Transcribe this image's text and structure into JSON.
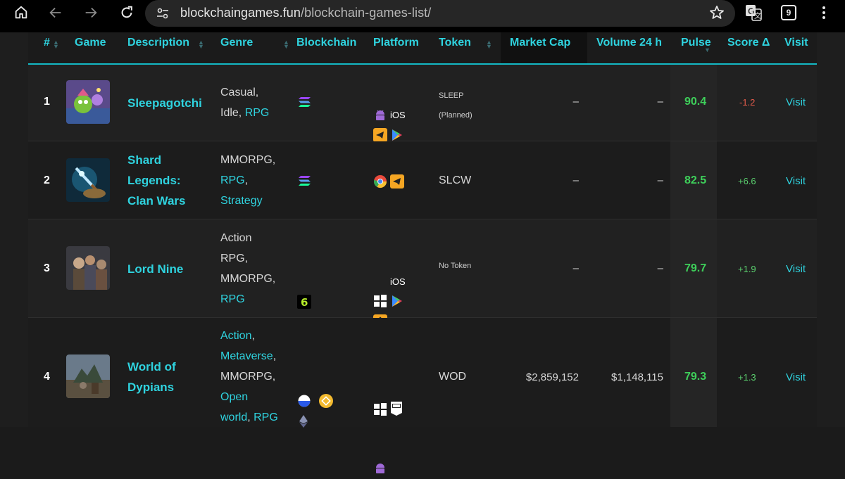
{
  "browser": {
    "url_domain": "blockchaingames.fun",
    "url_path": "/blockchain-games-list/",
    "tab_count": "9"
  },
  "table": {
    "headers": {
      "rank": "#",
      "game": "Game",
      "description": "Description",
      "genre": "Genre",
      "blockchain": "Blockchain",
      "platform": "Platform",
      "token": "Token",
      "market_cap": "Market Cap",
      "volume": "Volume 24 h",
      "pulse": "Pulse",
      "score": "Score Δ",
      "visit": "Visit"
    },
    "rows": [
      {
        "rank": "1",
        "name_lines": [
          "Sleepagotchi"
        ],
        "genre_plain": [
          "Casual,",
          "Idle, "
        ],
        "genre_link_last": "RPG",
        "blockchain": [
          "solana-icon"
        ],
        "platforms": [
          "android-icon",
          "ios-label",
          "telegram-icon",
          "google-play-icon",
          "app-store-icon"
        ],
        "ios_text": "iOS",
        "token_lines": [
          "SLEEP",
          "(Planned)"
        ],
        "market_cap": "–",
        "volume": "–",
        "pulse": "90.4",
        "score": "-1.2",
        "visit": "Visit"
      },
      {
        "rank": "2",
        "name_lines": [
          "Shard",
          "Legends:",
          "Clan Wars"
        ],
        "genre_line1": "MMORPG,",
        "genre_link2": "RPG",
        "genre_link3": "Strategy",
        "blockchain": [
          "solana-icon"
        ],
        "platforms": [
          "chrome-icon",
          "telegram-icon"
        ],
        "token": "SLCW",
        "market_cap": "–",
        "volume": "–",
        "pulse": "82.5",
        "score": "+6.6",
        "visit": "Visit"
      },
      {
        "rank": "3",
        "name_lines": [
          "Lord Nine"
        ],
        "genre_lines": [
          "Action",
          "RPG,",
          "MMORPG,"
        ],
        "genre_link_last": "RPG",
        "blockchain": [
          "mantle-icon"
        ],
        "platforms": [
          "android-icon",
          "ios-label",
          "windows-icon",
          "google-play-icon",
          "app-store-icon"
        ],
        "ios_text": "iOS",
        "token": "No Token",
        "market_cap": "–",
        "volume": "–",
        "pulse": "79.7",
        "score": "+1.9",
        "visit": "Visit"
      },
      {
        "rank": "4",
        "name_lines": [
          "World of",
          "Dypians"
        ],
        "genre_link1": "Action",
        "genre_link2": "Metaverse",
        "genre_line3": "MMORPG,",
        "genre_link4a": "Open",
        "genre_link4b": "world",
        "genre_link5": "RPG",
        "blockchain": [
          "base-icon",
          "bnb-icon",
          "ethereum-icon"
        ],
        "platforms": [
          "windows-icon",
          "epic-games-icon"
        ],
        "token": "WOD",
        "market_cap": "$2,859,152",
        "volume": "$1,148,115",
        "pulse": "79.3",
        "score": "+1.3",
        "visit": "Visit"
      }
    ]
  },
  "colors": {
    "accent": "#2fd3df",
    "pulse": "#3ecf5a",
    "negative": "#e55b4b",
    "positive": "#5bd16f"
  }
}
